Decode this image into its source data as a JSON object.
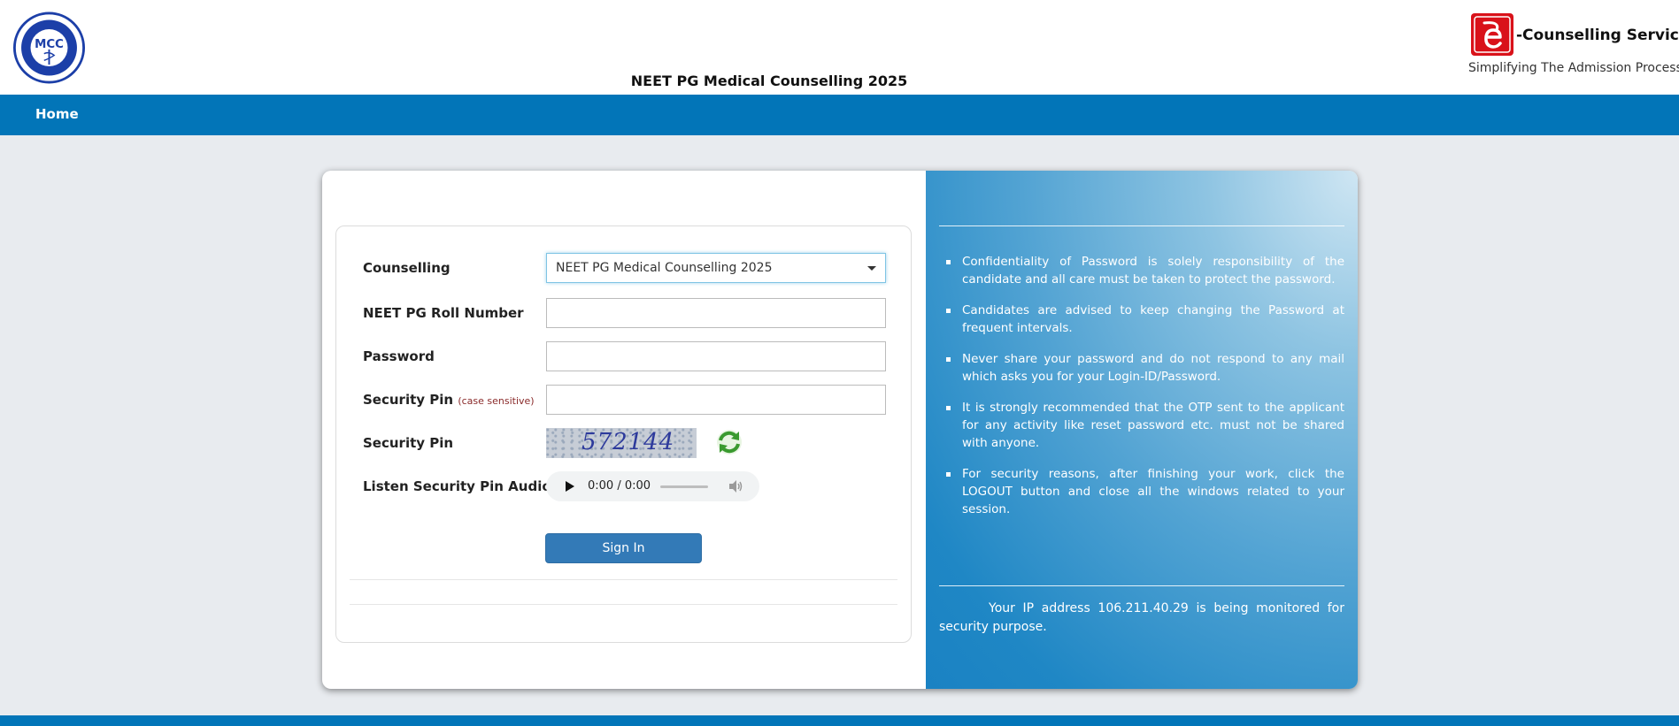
{
  "header": {
    "mcc_logo_text": "MCC",
    "title": "NEET PG Medical Counselling 2025",
    "ec_brand": "-Counselling Services",
    "ec_tagline": "Simplifying The Admission Process"
  },
  "nav": {
    "home_label": "Home"
  },
  "form": {
    "counselling_label": "Counselling",
    "counselling_value": "NEET PG Medical Counselling 2025",
    "roll_label": "NEET PG Roll Number",
    "roll_value": "",
    "password_label": "Password",
    "password_value": "",
    "pin_label": "Security Pin",
    "pin_note": "(case sensitive)",
    "pin_value": "",
    "captcha_label": "Security Pin",
    "captcha_text": "572144",
    "audio_label": "Listen Security Pin Audio",
    "audio_time": "0:00 / 0:00",
    "signin_label": "Sign In"
  },
  "info": {
    "bullets": [
      "Confidentiality of Password is solely responsibility of the candidate and all care must be taken to protect the password.",
      "Candidates are advised to keep changing the Password at frequent intervals.",
      "Never share your password and do not respond to any mail which asks you for your Login-ID/Password.",
      "It is strongly recommended that the OTP sent to the applicant for any activity like reset password etc. must not be shared with anyone.",
      "For security reasons, after finishing your work, click the LOGOUT button and close all the windows related to your session."
    ],
    "ip_note": "Your IP address 106.211.40.29 is being monitored for security purpose."
  },
  "colors": {
    "nav_blue": "#0275b8",
    "button_blue": "#337ab7",
    "logo_red": "#d9121a",
    "mcc_blue": "#1c3fa8"
  },
  "icons": {
    "refresh": "refresh-icon",
    "play": "play-icon",
    "volume": "volume-icon"
  }
}
